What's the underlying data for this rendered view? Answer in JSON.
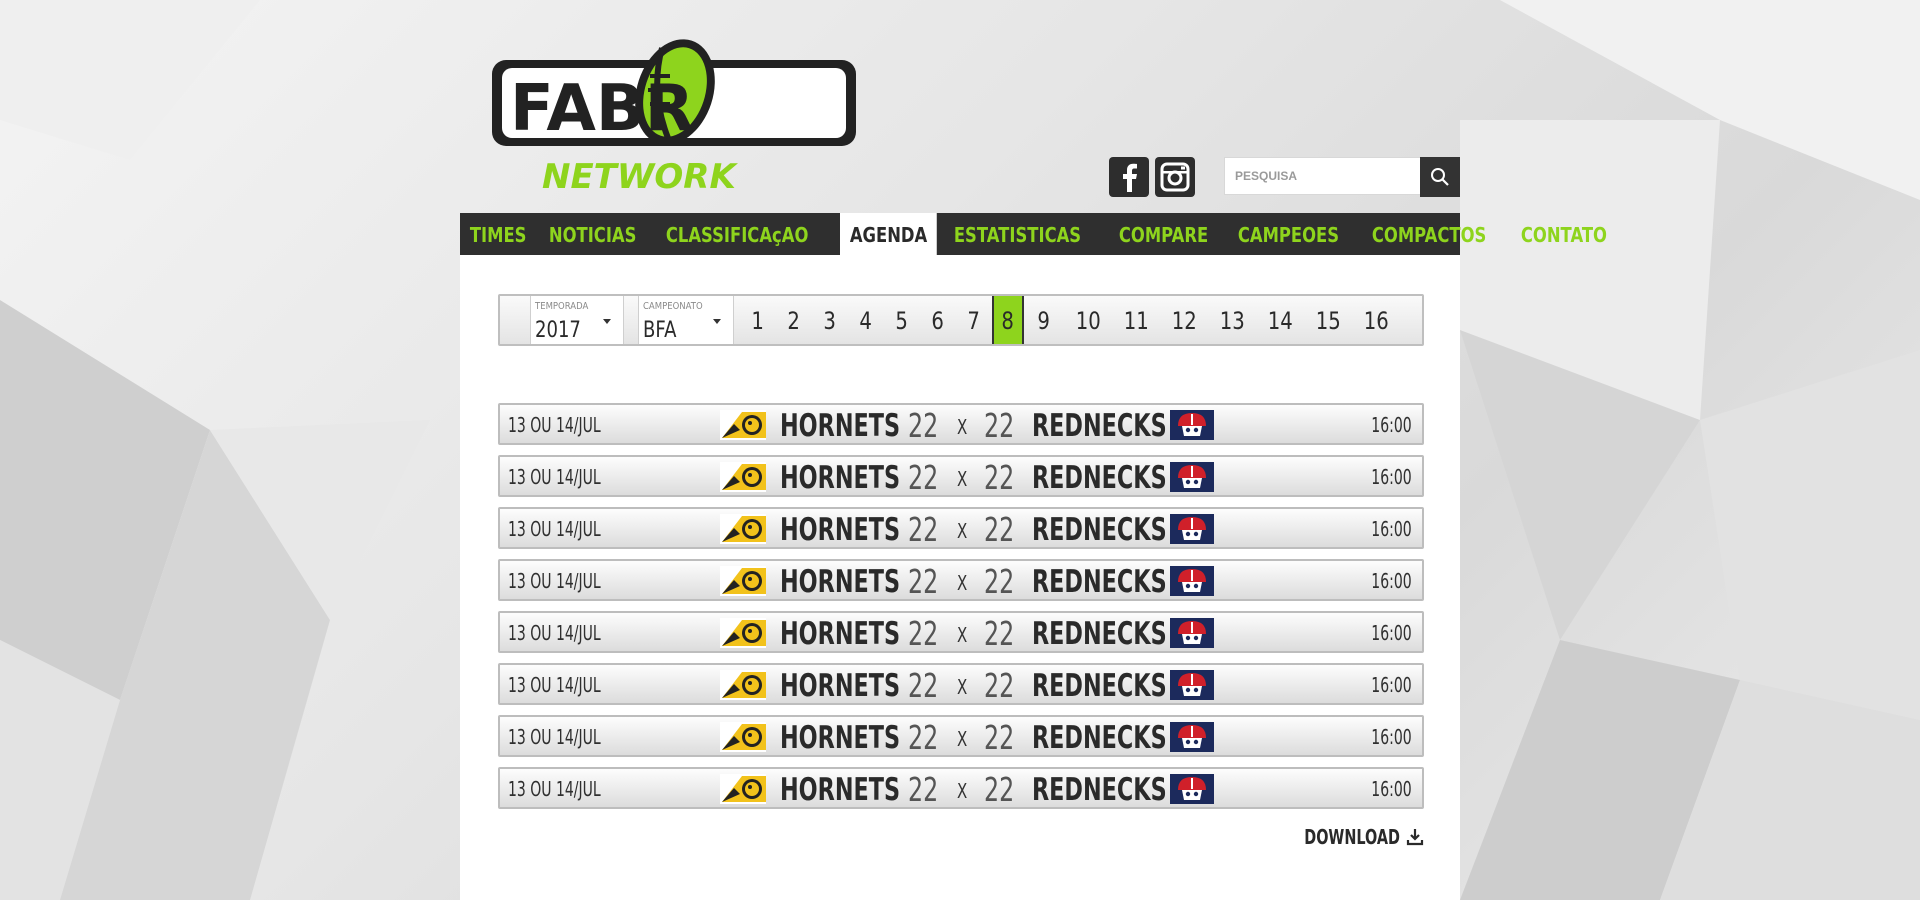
{
  "brand": {
    "logo_top": "FABR",
    "logo_bottom": "NETWORK",
    "accent": "#8ed41d",
    "dark": "#2f2f2f"
  },
  "social": [
    {
      "icon": "facebook-icon"
    },
    {
      "icon": "instagram-icon"
    }
  ],
  "search": {
    "placeholder": "PESQUISA"
  },
  "nav": {
    "items": [
      "TIMES",
      "NOTICIAS",
      "CLASSIFICAçAO",
      "AGENDA",
      "ESTATISTICAS",
      "COMPARE",
      "CAMPEOES",
      "COMPACTOS",
      "CONTATO"
    ],
    "active": "AGENDA"
  },
  "filter": {
    "season": {
      "label": "TEMPORADA",
      "value": "2017"
    },
    "championship": {
      "label": "CAMPEONATO",
      "value": "BFA"
    },
    "rounds": [
      "1",
      "2",
      "3",
      "4",
      "5",
      "6",
      "7",
      "8",
      "9",
      "10",
      "11",
      "12",
      "13",
      "14",
      "15",
      "16"
    ],
    "active_round": "8"
  },
  "games": [
    {
      "date": "13 OU 14/JUL",
      "home": "HORNETS",
      "home_score": "22",
      "sep": "X",
      "away_score": "22",
      "away": "REDNECKS",
      "time": "16:00"
    },
    {
      "date": "13 OU 14/JUL",
      "home": "HORNETS",
      "home_score": "22",
      "sep": "X",
      "away_score": "22",
      "away": "REDNECKS",
      "time": "16:00"
    },
    {
      "date": "13 OU 14/JUL",
      "home": "HORNETS",
      "home_score": "22",
      "sep": "X",
      "away_score": "22",
      "away": "REDNECKS",
      "time": "16:00"
    },
    {
      "date": "13 OU 14/JUL",
      "home": "HORNETS",
      "home_score": "22",
      "sep": "X",
      "away_score": "22",
      "away": "REDNECKS",
      "time": "16:00"
    },
    {
      "date": "13 OU 14/JUL",
      "home": "HORNETS",
      "home_score": "22",
      "sep": "X",
      "away_score": "22",
      "away": "REDNECKS",
      "time": "16:00"
    },
    {
      "date": "13 OU 14/JUL",
      "home": "HORNETS",
      "home_score": "22",
      "sep": "X",
      "away_score": "22",
      "away": "REDNECKS",
      "time": "16:00"
    },
    {
      "date": "13 OU 14/JUL",
      "home": "HORNETS",
      "home_score": "22",
      "sep": "X",
      "away_score": "22",
      "away": "REDNECKS",
      "time": "16:00"
    },
    {
      "date": "13 OU 14/JUL",
      "home": "HORNETS",
      "home_score": "22",
      "sep": "X",
      "away_score": "22",
      "away": "REDNECKS",
      "time": "16:00"
    }
  ],
  "download": {
    "label": "DOWNLOAD",
    "icon": "download-icon"
  }
}
